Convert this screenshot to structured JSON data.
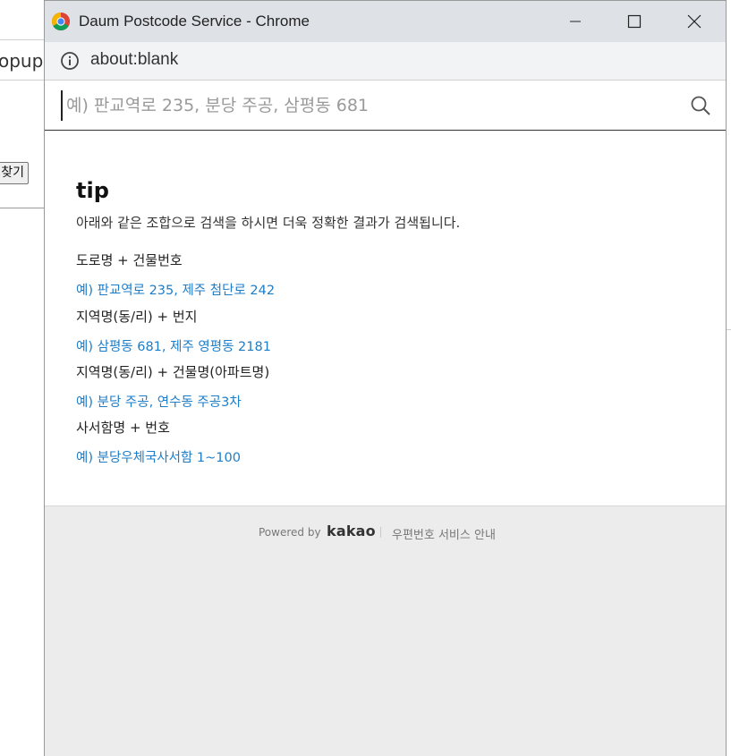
{
  "background": {
    "url_fragment": "opup?",
    "button_label": "찾기"
  },
  "window": {
    "title": "Daum Postcode Service - Chrome",
    "url": "about:blank"
  },
  "search": {
    "placeholder": "예) 판교역로 235, 분당 주공, 삼평동 681",
    "value": ""
  },
  "tip": {
    "title": "tip",
    "description": "아래와 같은 조합으로 검색을 하시면 더욱 정확한 결과가 검색됩니다.",
    "items": [
      {
        "heading": "도로명 + 건물번호",
        "example": "예) 판교역로 235,  제주 첨단로 242"
      },
      {
        "heading": "지역명(동/리) + 번지",
        "example": "예) 삼평동 681,  제주 영평동 2181"
      },
      {
        "heading": "지역명(동/리) + 건물명(아파트명)",
        "example": "예) 분당 주공,  연수동 주공3차"
      },
      {
        "heading": "사서함명 + 번호",
        "example": "예) 분당우체국사서함 1~100"
      }
    ]
  },
  "footer": {
    "powered_by": "Powered by",
    "brand": "kakao",
    "service_link": "우편번호 서비스 안내"
  },
  "icons": {
    "app": "chrome-icon",
    "info": "info-icon",
    "search": "search-icon",
    "minimize": "minimize-icon",
    "maximize": "maximize-icon",
    "close": "close-icon"
  },
  "colors": {
    "example_text": "#1e7dc7",
    "titlebar": "#dee1e6",
    "footer_bg": "#ececec"
  }
}
